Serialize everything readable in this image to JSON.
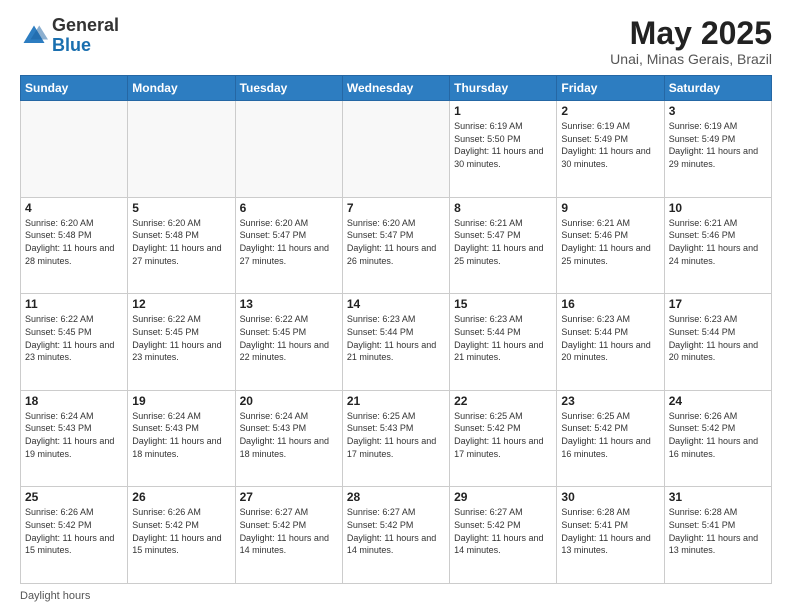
{
  "header": {
    "logo_general": "General",
    "logo_blue": "Blue",
    "title": "May 2025",
    "subtitle": "Unai, Minas Gerais, Brazil"
  },
  "days_of_week": [
    "Sunday",
    "Monday",
    "Tuesday",
    "Wednesday",
    "Thursday",
    "Friday",
    "Saturday"
  ],
  "weeks": [
    [
      {
        "day": "",
        "sunrise": "",
        "sunset": "",
        "daylight": ""
      },
      {
        "day": "",
        "sunrise": "",
        "sunset": "",
        "daylight": ""
      },
      {
        "day": "",
        "sunrise": "",
        "sunset": "",
        "daylight": ""
      },
      {
        "day": "",
        "sunrise": "",
        "sunset": "",
        "daylight": ""
      },
      {
        "day": "1",
        "sunrise": "Sunrise: 6:19 AM",
        "sunset": "Sunset: 5:50 PM",
        "daylight": "Daylight: 11 hours and 30 minutes."
      },
      {
        "day": "2",
        "sunrise": "Sunrise: 6:19 AM",
        "sunset": "Sunset: 5:49 PM",
        "daylight": "Daylight: 11 hours and 30 minutes."
      },
      {
        "day": "3",
        "sunrise": "Sunrise: 6:19 AM",
        "sunset": "Sunset: 5:49 PM",
        "daylight": "Daylight: 11 hours and 29 minutes."
      }
    ],
    [
      {
        "day": "4",
        "sunrise": "Sunrise: 6:20 AM",
        "sunset": "Sunset: 5:48 PM",
        "daylight": "Daylight: 11 hours and 28 minutes."
      },
      {
        "day": "5",
        "sunrise": "Sunrise: 6:20 AM",
        "sunset": "Sunset: 5:48 PM",
        "daylight": "Daylight: 11 hours and 27 minutes."
      },
      {
        "day": "6",
        "sunrise": "Sunrise: 6:20 AM",
        "sunset": "Sunset: 5:47 PM",
        "daylight": "Daylight: 11 hours and 27 minutes."
      },
      {
        "day": "7",
        "sunrise": "Sunrise: 6:20 AM",
        "sunset": "Sunset: 5:47 PM",
        "daylight": "Daylight: 11 hours and 26 minutes."
      },
      {
        "day": "8",
        "sunrise": "Sunrise: 6:21 AM",
        "sunset": "Sunset: 5:47 PM",
        "daylight": "Daylight: 11 hours and 25 minutes."
      },
      {
        "day": "9",
        "sunrise": "Sunrise: 6:21 AM",
        "sunset": "Sunset: 5:46 PM",
        "daylight": "Daylight: 11 hours and 25 minutes."
      },
      {
        "day": "10",
        "sunrise": "Sunrise: 6:21 AM",
        "sunset": "Sunset: 5:46 PM",
        "daylight": "Daylight: 11 hours and 24 minutes."
      }
    ],
    [
      {
        "day": "11",
        "sunrise": "Sunrise: 6:22 AM",
        "sunset": "Sunset: 5:45 PM",
        "daylight": "Daylight: 11 hours and 23 minutes."
      },
      {
        "day": "12",
        "sunrise": "Sunrise: 6:22 AM",
        "sunset": "Sunset: 5:45 PM",
        "daylight": "Daylight: 11 hours and 23 minutes."
      },
      {
        "day": "13",
        "sunrise": "Sunrise: 6:22 AM",
        "sunset": "Sunset: 5:45 PM",
        "daylight": "Daylight: 11 hours and 22 minutes."
      },
      {
        "day": "14",
        "sunrise": "Sunrise: 6:23 AM",
        "sunset": "Sunset: 5:44 PM",
        "daylight": "Daylight: 11 hours and 21 minutes."
      },
      {
        "day": "15",
        "sunrise": "Sunrise: 6:23 AM",
        "sunset": "Sunset: 5:44 PM",
        "daylight": "Daylight: 11 hours and 21 minutes."
      },
      {
        "day": "16",
        "sunrise": "Sunrise: 6:23 AM",
        "sunset": "Sunset: 5:44 PM",
        "daylight": "Daylight: 11 hours and 20 minutes."
      },
      {
        "day": "17",
        "sunrise": "Sunrise: 6:23 AM",
        "sunset": "Sunset: 5:44 PM",
        "daylight": "Daylight: 11 hours and 20 minutes."
      }
    ],
    [
      {
        "day": "18",
        "sunrise": "Sunrise: 6:24 AM",
        "sunset": "Sunset: 5:43 PM",
        "daylight": "Daylight: 11 hours and 19 minutes."
      },
      {
        "day": "19",
        "sunrise": "Sunrise: 6:24 AM",
        "sunset": "Sunset: 5:43 PM",
        "daylight": "Daylight: 11 hours and 18 minutes."
      },
      {
        "day": "20",
        "sunrise": "Sunrise: 6:24 AM",
        "sunset": "Sunset: 5:43 PM",
        "daylight": "Daylight: 11 hours and 18 minutes."
      },
      {
        "day": "21",
        "sunrise": "Sunrise: 6:25 AM",
        "sunset": "Sunset: 5:43 PM",
        "daylight": "Daylight: 11 hours and 17 minutes."
      },
      {
        "day": "22",
        "sunrise": "Sunrise: 6:25 AM",
        "sunset": "Sunset: 5:42 PM",
        "daylight": "Daylight: 11 hours and 17 minutes."
      },
      {
        "day": "23",
        "sunrise": "Sunrise: 6:25 AM",
        "sunset": "Sunset: 5:42 PM",
        "daylight": "Daylight: 11 hours and 16 minutes."
      },
      {
        "day": "24",
        "sunrise": "Sunrise: 6:26 AM",
        "sunset": "Sunset: 5:42 PM",
        "daylight": "Daylight: 11 hours and 16 minutes."
      }
    ],
    [
      {
        "day": "25",
        "sunrise": "Sunrise: 6:26 AM",
        "sunset": "Sunset: 5:42 PM",
        "daylight": "Daylight: 11 hours and 15 minutes."
      },
      {
        "day": "26",
        "sunrise": "Sunrise: 6:26 AM",
        "sunset": "Sunset: 5:42 PM",
        "daylight": "Daylight: 11 hours and 15 minutes."
      },
      {
        "day": "27",
        "sunrise": "Sunrise: 6:27 AM",
        "sunset": "Sunset: 5:42 PM",
        "daylight": "Daylight: 11 hours and 14 minutes."
      },
      {
        "day": "28",
        "sunrise": "Sunrise: 6:27 AM",
        "sunset": "Sunset: 5:42 PM",
        "daylight": "Daylight: 11 hours and 14 minutes."
      },
      {
        "day": "29",
        "sunrise": "Sunrise: 6:27 AM",
        "sunset": "Sunset: 5:42 PM",
        "daylight": "Daylight: 11 hours and 14 minutes."
      },
      {
        "day": "30",
        "sunrise": "Sunrise: 6:28 AM",
        "sunset": "Sunset: 5:41 PM",
        "daylight": "Daylight: 11 hours and 13 minutes."
      },
      {
        "day": "31",
        "sunrise": "Sunrise: 6:28 AM",
        "sunset": "Sunset: 5:41 PM",
        "daylight": "Daylight: 11 hours and 13 minutes."
      }
    ]
  ],
  "footer": {
    "daylight_hours": "Daylight hours"
  }
}
